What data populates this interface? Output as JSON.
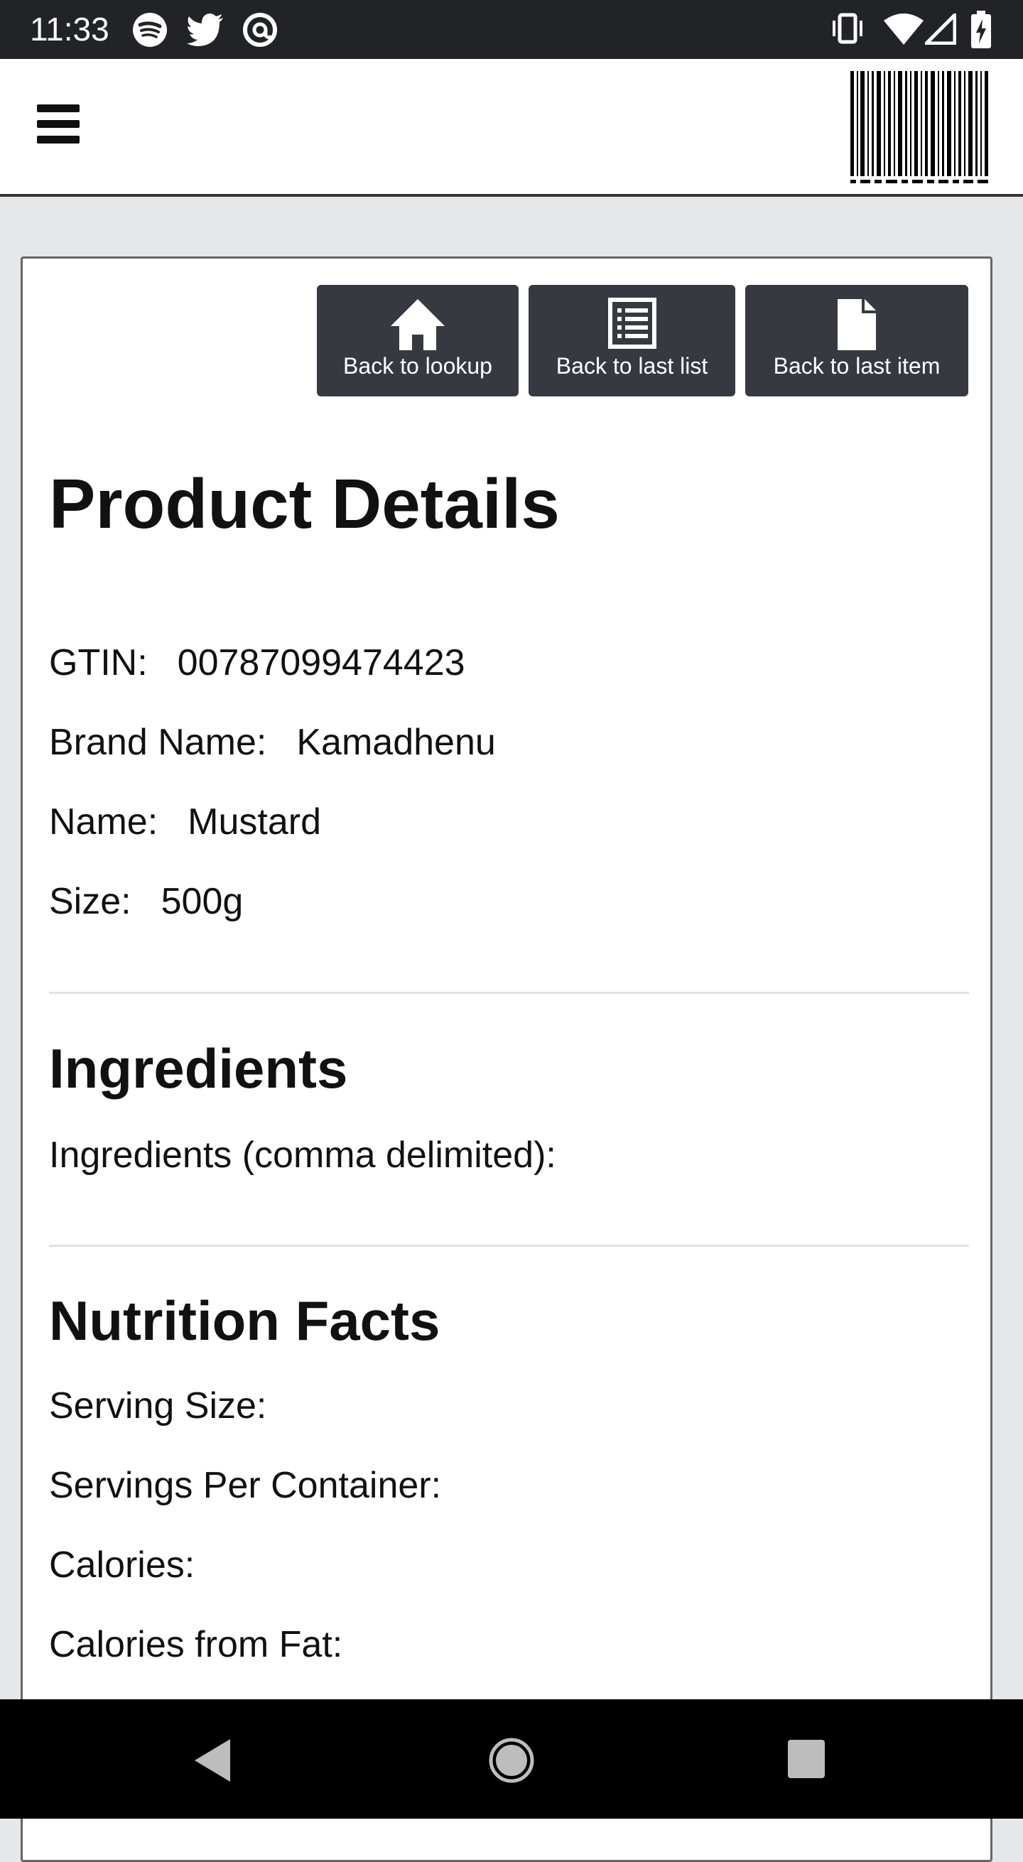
{
  "status_bar": {
    "time": "11:33",
    "left_icons": [
      "spotify-icon",
      "twitter-icon",
      "at-sign-icon"
    ],
    "right_icons": [
      "vibrate-icon",
      "wifi-icon",
      "cell-signal-icon",
      "battery-charging-icon"
    ]
  },
  "header": {
    "menu_icon": "hamburger-menu-icon",
    "logo_icon": "barcode-icon"
  },
  "actions": [
    {
      "label": "Back to lookup",
      "icon": "home-icon"
    },
    {
      "label": "Back to last list",
      "icon": "list-icon"
    },
    {
      "label": "Back to last item",
      "icon": "document-icon"
    }
  ],
  "product": {
    "title": "Product Details",
    "gtin_label": "GTIN:",
    "gtin_value": "00787099474423",
    "brand_label": "Brand Name:",
    "brand_value": "Kamadhenu",
    "name_label": "Name:",
    "name_value": "Mustard",
    "size_label": "Size:",
    "size_value": "500g"
  },
  "ingredients": {
    "title": "Ingredients",
    "label": "Ingredients (comma delimited):"
  },
  "nutrition": {
    "title": "Nutrition Facts",
    "serving_size_label": "Serving Size:",
    "servings_per_container_label": "Servings Per Container:",
    "calories_label": "Calories:",
    "calories_from_fat_label": "Calories from Fat:"
  },
  "system_nav": {
    "back_icon": "back-triangle-icon",
    "home_icon": "home-circle-icon",
    "recents_icon": "recents-square-icon"
  },
  "colors": {
    "button_bg": "#363a40",
    "page_bg": "#e6e7e9",
    "status_bar_bg": "#222326"
  }
}
